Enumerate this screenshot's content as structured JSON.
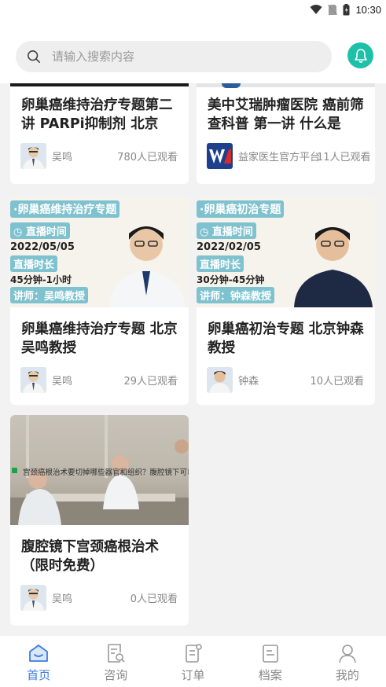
{
  "status_bar": {
    "time": "10:30"
  },
  "search": {
    "placeholder": "请输入搜索内容"
  },
  "cards": [
    {
      "title": "卵巢癌维持治疗专题第二讲 PARPi抑制剂 北京",
      "doctor": "吴鸣",
      "views": "780人已观看"
    },
    {
      "title": "美中艾瑞肿瘤医院 癌前筛查科普 第一讲 什么是",
      "doctor": "益家医生官方平台",
      "views": "11人已观看"
    },
    {
      "title": "卵巢癌维持治疗专题 北京吴鸣教授",
      "doctor": "吴鸣",
      "views": "29人已观看",
      "banner": {
        "heading": "·卵巢癌维持治疗专题",
        "time_label": "直播时间",
        "date": "2022/05/05",
        "duration_label": "直播时长",
        "duration": "45分钟-1小时",
        "lecturer": "讲师：吴鸣教授"
      }
    },
    {
      "title": "卵巢癌初治专题 北京钟森教授",
      "doctor": "钟森",
      "views": "10人已观看",
      "banner": {
        "heading": "·卵巢癌初治专题",
        "time_label": "直播时间",
        "date": "2022/02/05",
        "duration_label": "直播时长",
        "duration": "30分钟-45分钟",
        "lecturer": "讲师：钟森教授"
      }
    },
    {
      "title": "腹腔镜下宫颈癌根治术（限时免费）",
      "doctor": "吴鸣",
      "views": "0人已观看",
      "banner": {
        "caption": "宫颈癌根治术要切掉哪些器官和组织？腹腔镜下可以做吗？"
      }
    }
  ],
  "nav": [
    {
      "label": "首页",
      "icon": "home-icon",
      "active": true
    },
    {
      "label": "咨询",
      "icon": "consult-icon",
      "active": false
    },
    {
      "label": "订单",
      "icon": "order-icon",
      "active": false
    },
    {
      "label": "档案",
      "icon": "archive-icon",
      "active": false
    },
    {
      "label": "我的",
      "icon": "profile-icon",
      "active": false
    }
  ],
  "colors": {
    "accent": "#1fc0a8",
    "active_tab": "#3d7be6",
    "banner_tag": "#7fc2cf"
  }
}
